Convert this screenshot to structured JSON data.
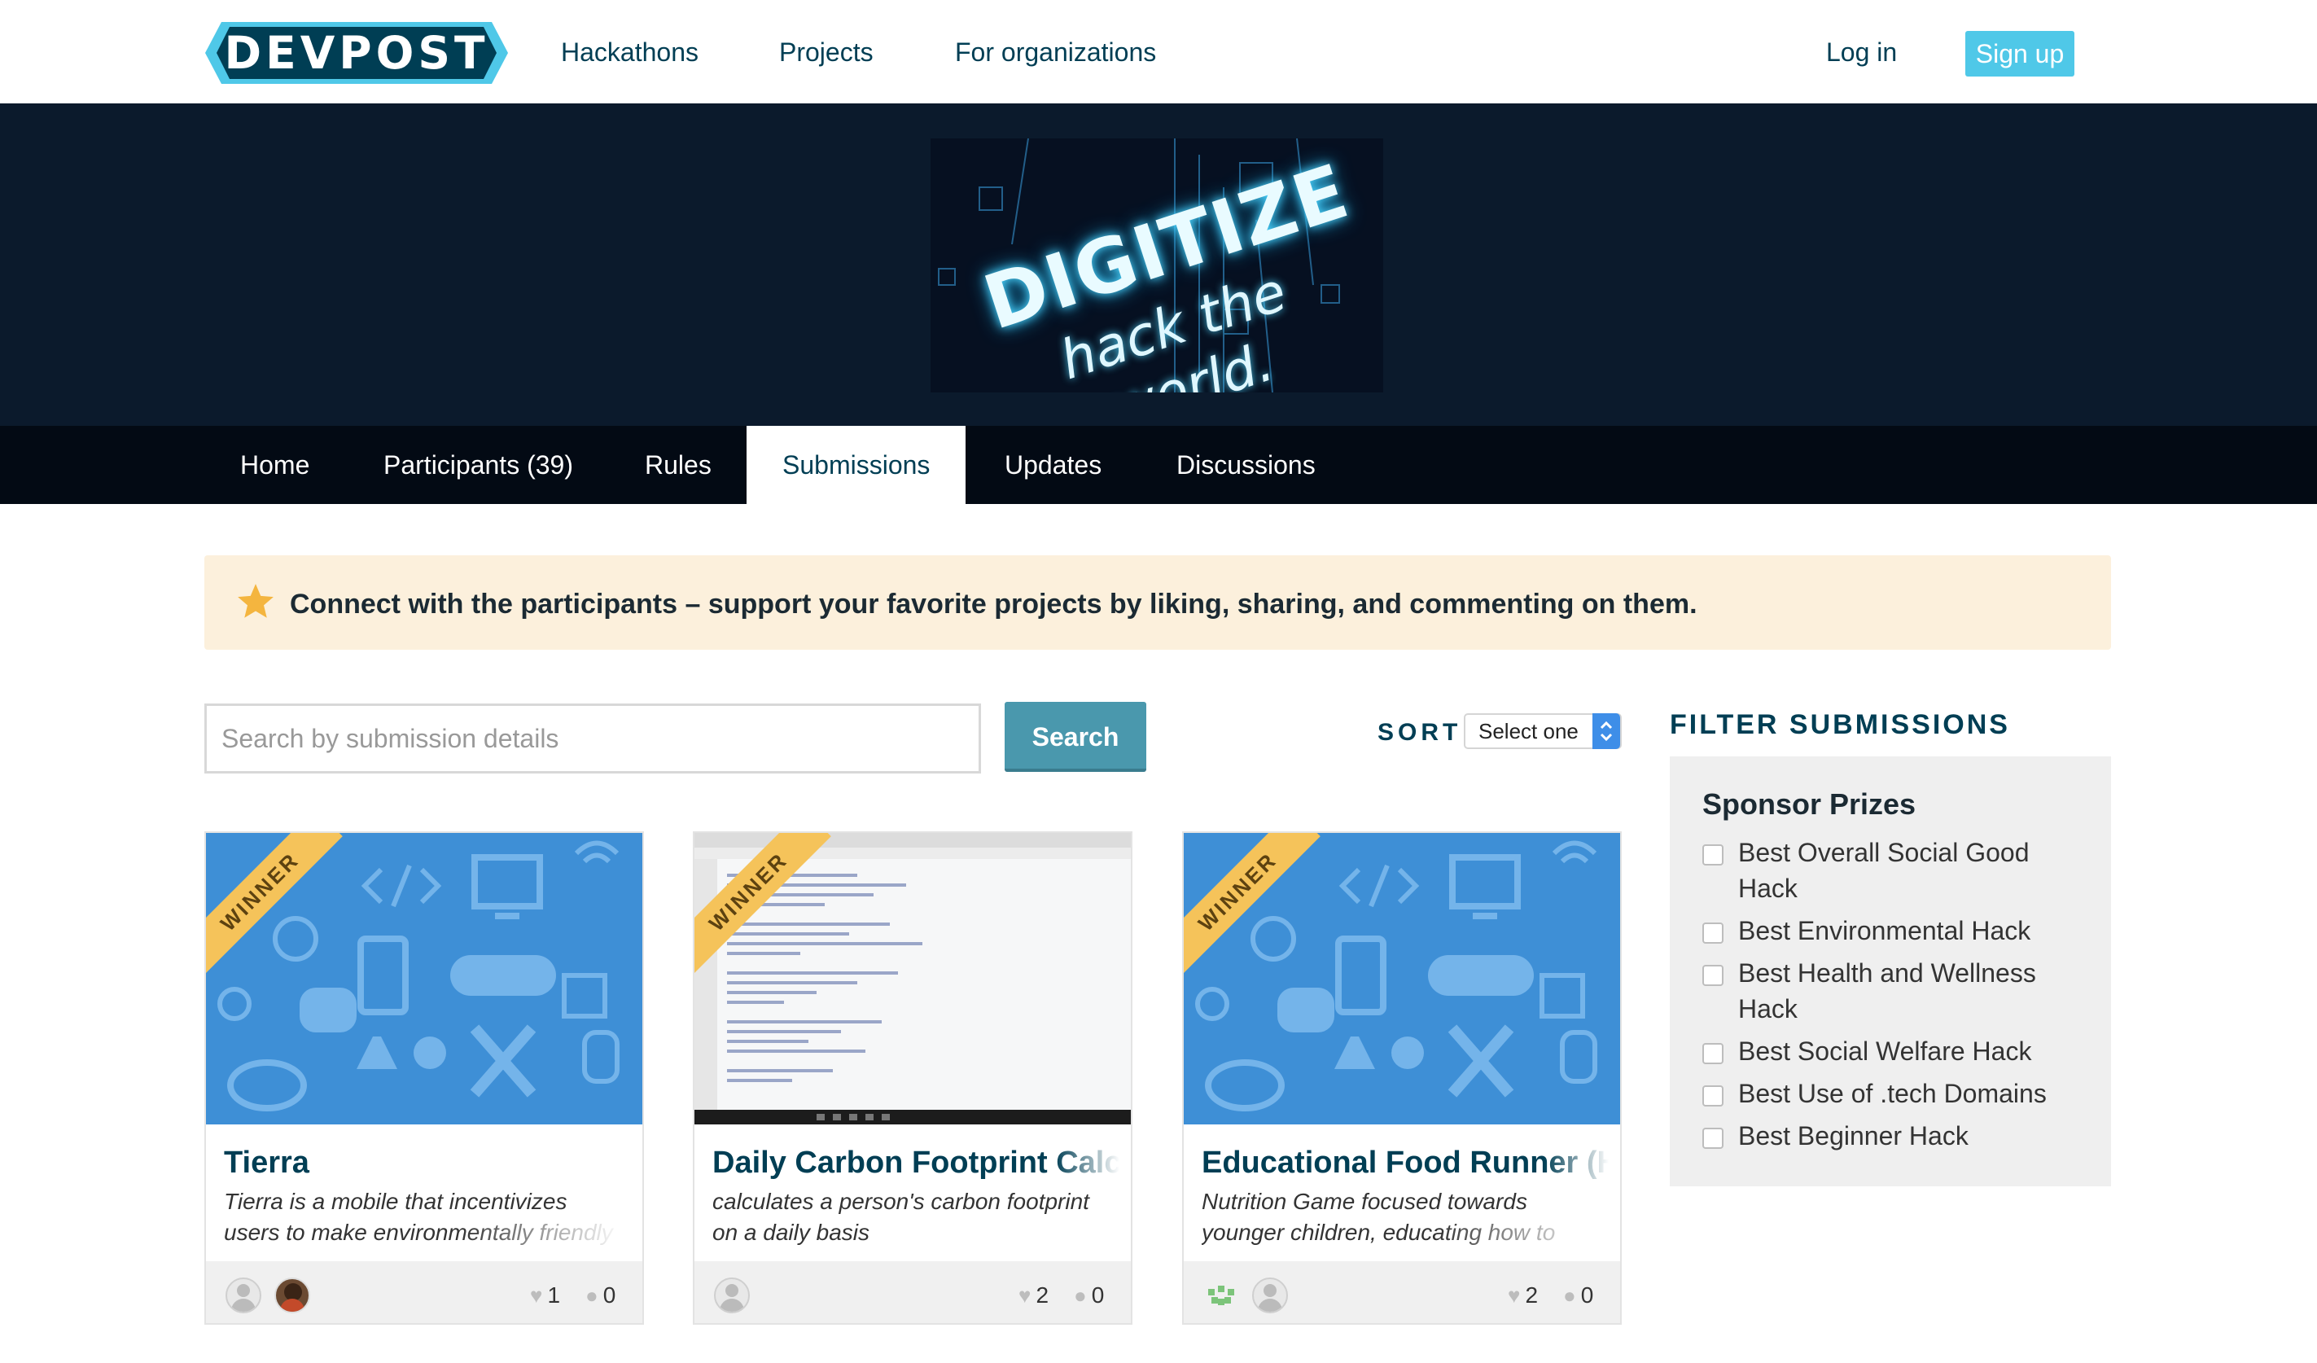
{
  "header": {
    "logo": "DEVPOST",
    "nav": [
      "Hackathons",
      "Projects",
      "For organizations"
    ],
    "login": "Log in",
    "signup": "Sign up"
  },
  "banner": {
    "title": "DIGITIZE",
    "subtitle": "hack the world."
  },
  "tabs": [
    {
      "label": "Home",
      "active": false
    },
    {
      "label": "Participants (39)",
      "active": false
    },
    {
      "label": "Rules",
      "active": false
    },
    {
      "label": "Submissions",
      "active": true
    },
    {
      "label": "Updates",
      "active": false
    },
    {
      "label": "Discussions",
      "active": false
    }
  ],
  "notice": {
    "icon": "star-icon",
    "text": "Connect with the participants – support your favorite projects by liking, sharing, and commenting on them."
  },
  "search": {
    "placeholder": "Search by submission details",
    "value": "",
    "button": "Search"
  },
  "sort": {
    "label": "SORT",
    "selected": "Select one"
  },
  "submissions": [
    {
      "title": "Tierra",
      "description": "Tierra is a mobile that incentivizes users to make environmentally friendly",
      "winner": "WINNER",
      "likes": "1",
      "comments": "0",
      "thumbnail": "placeholder-icons"
    },
    {
      "title": "Daily Carbon Footprint Calcul",
      "description": "calculates a person's carbon footprint on a daily basis",
      "winner": "WINNER",
      "likes": "2",
      "comments": "0",
      "thumbnail": "code-screenshot"
    },
    {
      "title": "Educational Food Runner (Ha",
      "description": "Nutrition Game focused towards younger children, educating how to",
      "winner": "WINNER",
      "likes": "2",
      "comments": "0",
      "thumbnail": "placeholder-icons"
    }
  ],
  "filter": {
    "title": "FILTER SUBMISSIONS",
    "section": "Sponsor Prizes",
    "prizes": [
      {
        "label": "Best Overall Social Good Hack",
        "checked": false
      },
      {
        "label": "Best Environmental Hack",
        "checked": false
      },
      {
        "label": "Best Health and Wellness Hack",
        "checked": false
      },
      {
        "label": "Best Social Welfare Hack",
        "checked": false
      },
      {
        "label": "Best Use of .tech Domains",
        "checked": false
      },
      {
        "label": "Best Beginner Hack",
        "checked": false
      }
    ]
  },
  "colors": {
    "accent": "#4fc8e8",
    "navy": "#003e54",
    "winner_ribbon": "#f5c35a",
    "notice_bg": "#fcf0dc",
    "search_button": "#4a98ad"
  }
}
